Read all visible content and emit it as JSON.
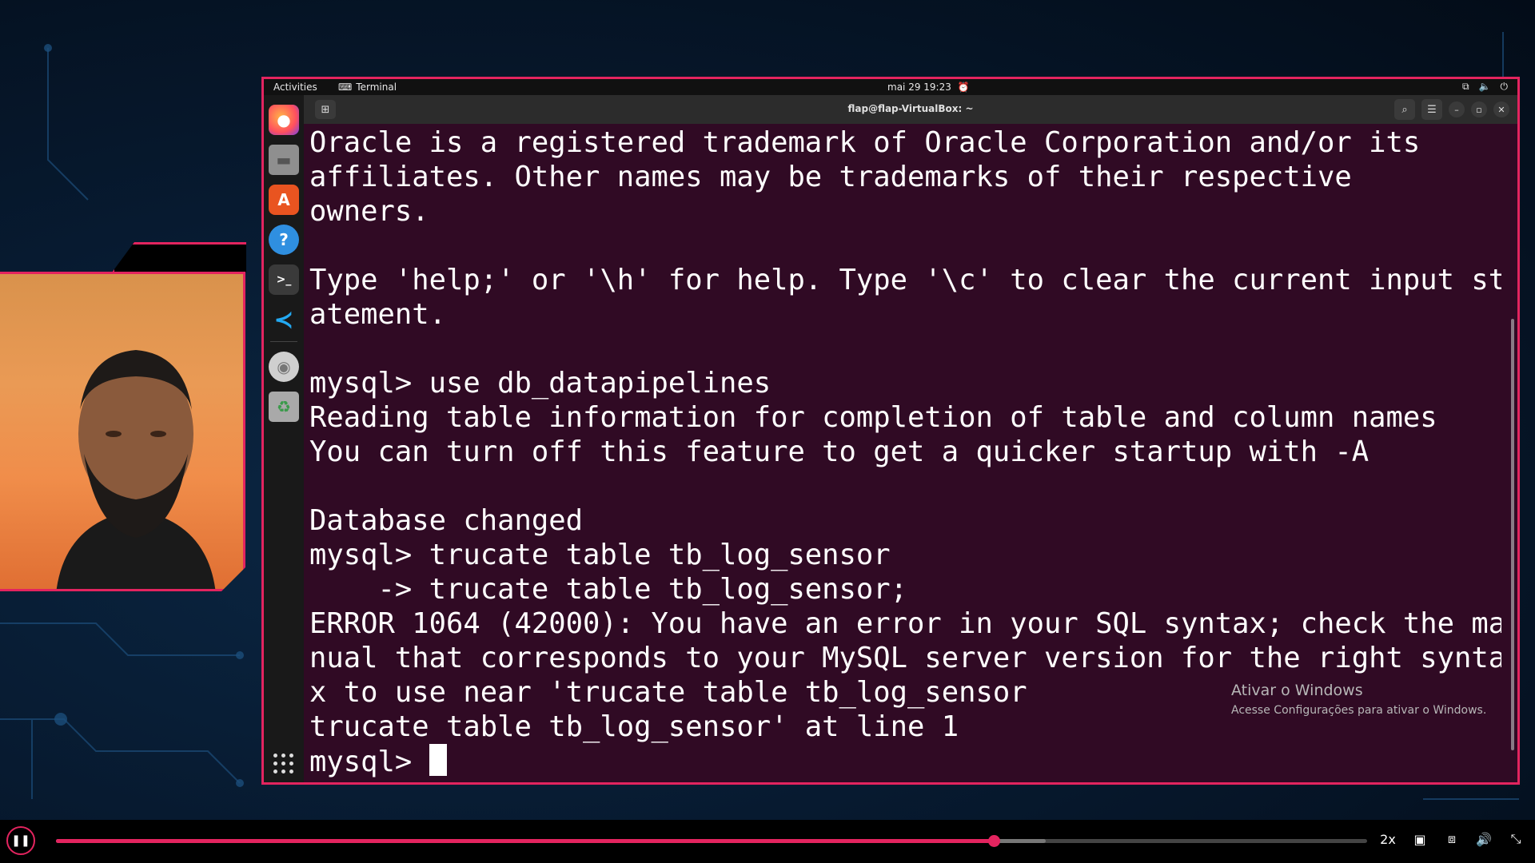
{
  "topbar": {
    "activities": "Activities",
    "app_name": "Terminal",
    "clock": "mai 29  19:23"
  },
  "window": {
    "title": "flap@flap-VirtualBox: ~"
  },
  "terminal": {
    "lines": [
      "Oracle is a registered trademark of Oracle Corporation and/or its",
      "affiliates. Other names may be trademarks of their respective",
      "owners.",
      "",
      "Type 'help;' or '\\h' for help. Type '\\c' to clear the current input st",
      "atement.",
      "",
      "mysql> use db_datapipelines",
      "Reading table information for completion of table and column names",
      "You can turn off this feature to get a quicker startup with -A",
      "",
      "Database changed",
      "mysql> trucate table tb_log_sensor",
      "    -> trucate table tb_log_sensor;",
      "ERROR 1064 (42000): You have an error in your SQL syntax; check the ma",
      "nual that corresponds to your MySQL server version for the right synta",
      "x to use near 'trucate table tb_log_sensor",
      "trucate table tb_log_sensor' at line 1"
    ],
    "prompt": "mysql> "
  },
  "watermark": {
    "line1": "Ativar o Windows",
    "line2": "Acesse Configurações para ativar o Windows."
  },
  "player": {
    "speed": "2x",
    "progress": 0.715,
    "buffered": 0.755
  },
  "dock_icons": [
    "firefox-icon",
    "files-icon",
    "app-center-icon",
    "help-icon",
    "terminal-icon",
    "vscode-icon",
    "disc-icon",
    "trash-icon"
  ],
  "colors": {
    "accent": "#e3245f",
    "terminal_bg": "#300a24"
  }
}
